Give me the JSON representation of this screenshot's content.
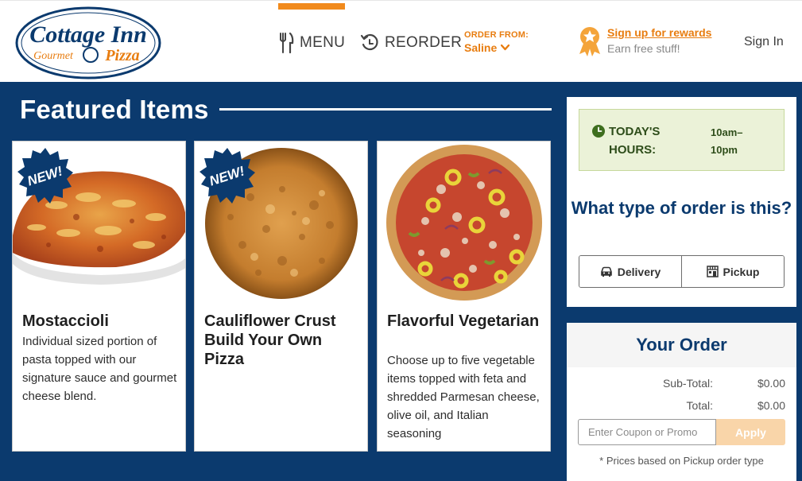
{
  "brand": {
    "line1": "Cottage Inn",
    "line2": "Gourmet",
    "line3": "Pizza",
    "colors": {
      "navy": "#0b3a6e",
      "orange": "#e87d10"
    }
  },
  "nav": {
    "menu_label": "MENU",
    "reorder_label": "REORDER",
    "order_from_label": "ORDER FROM:",
    "order_from_value": "Saline",
    "rewards_link": "Sign up for rewards",
    "rewards_sub": "Earn free stuff!",
    "sign_in": "Sign In"
  },
  "featured": {
    "title": "Featured Items",
    "new_badge": "NEW!",
    "items": [
      {
        "title": "Mostaccioli",
        "description": "Individual sized portion of pasta topped with our signature sauce and gourmet cheese blend.",
        "is_new": true
      },
      {
        "title": "Cauliflower Crust Build Your Own Pizza",
        "description": "",
        "is_new": true
      },
      {
        "title": "Flavorful Vegetarian",
        "description": "Choose up to five vegetable items topped with feta and shredded Parmesan cheese, olive oil, and Italian seasoning",
        "is_new": false
      }
    ]
  },
  "hours": {
    "label": "TODAY'S HOURS:",
    "value": "10am–10pm"
  },
  "order_type": {
    "question": "What type of order is this?",
    "delivery_label": "Delivery",
    "pickup_label": "Pickup"
  },
  "your_order": {
    "title": "Your Order",
    "subtotal_label": "Sub-Total:",
    "subtotal_value": "$0.00",
    "total_label": "Total:",
    "total_value": "$0.00",
    "coupon_placeholder": "Enter Coupon or Promo",
    "apply_label": "Apply",
    "prices_note": "* Prices based on Pickup order type"
  }
}
